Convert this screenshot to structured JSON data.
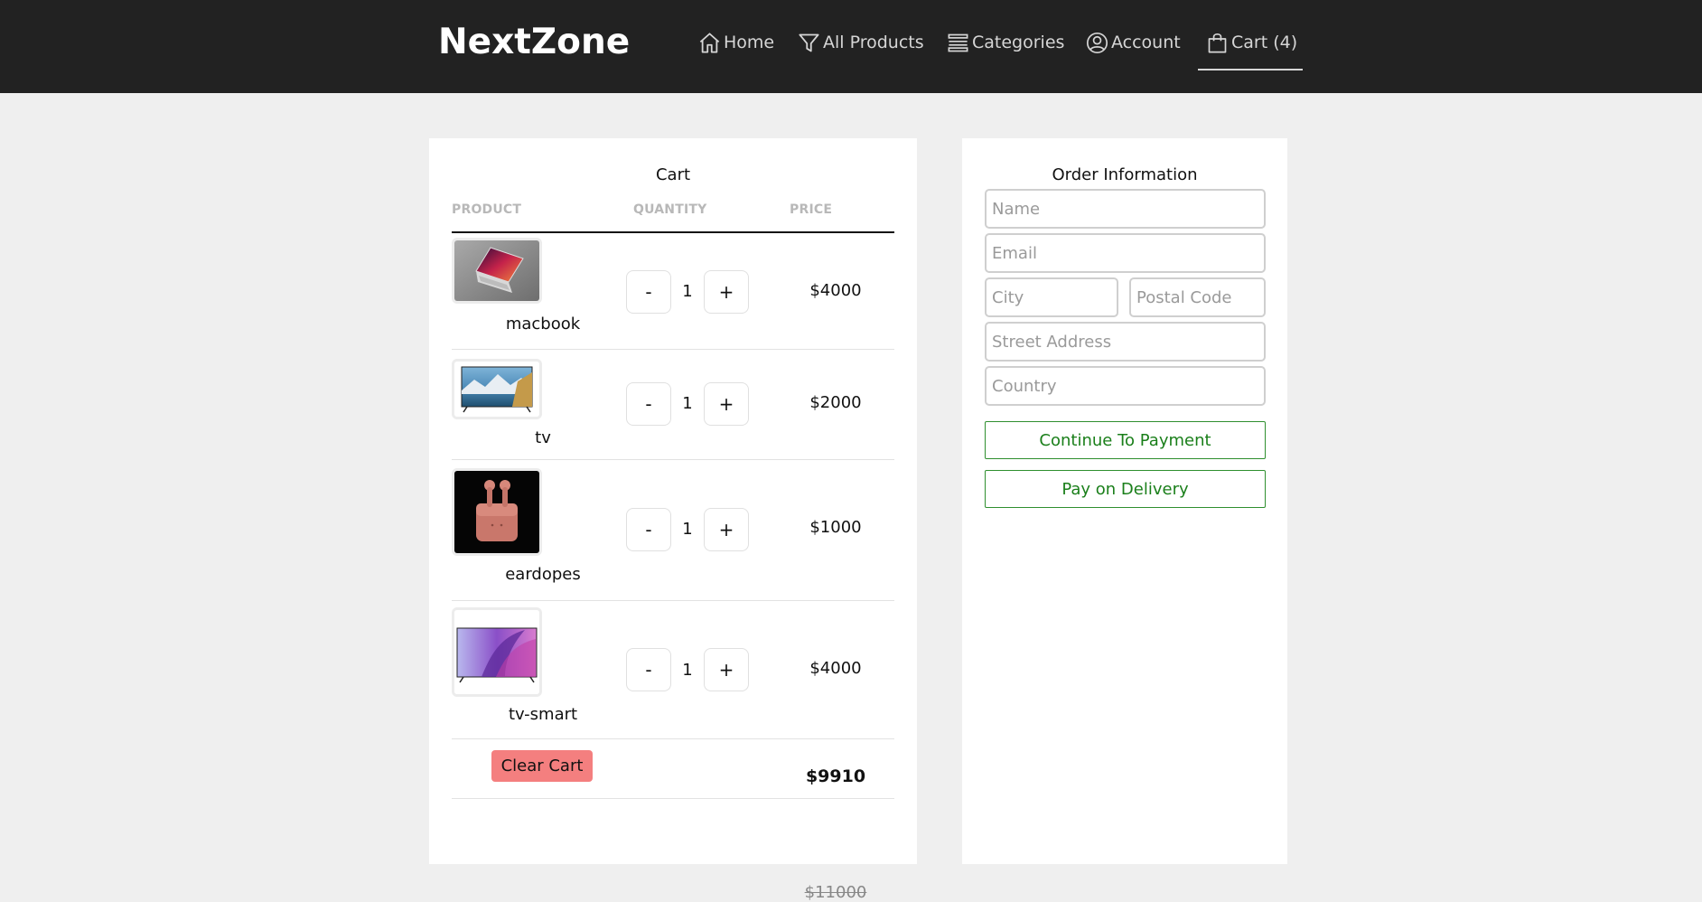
{
  "header": {
    "logo": "NextZone",
    "nav": [
      {
        "label": "Home",
        "icon": "home-icon"
      },
      {
        "label": "All Products",
        "icon": "filter-icon"
      },
      {
        "label": "Categories",
        "icon": "layers-icon"
      },
      {
        "label": "Account",
        "icon": "user-circle-icon"
      },
      {
        "label": "Cart (4)",
        "icon": "shopping-bag-icon",
        "active": true
      }
    ]
  },
  "cart": {
    "title": "Cart",
    "columns": [
      "PRODUCT",
      "QUANTITY",
      "PRICE"
    ],
    "items": [
      {
        "name": "macbook",
        "quantity": "1",
        "price": "$4000",
        "image": "laptop"
      },
      {
        "name": "tv",
        "quantity": "1",
        "price": "$2000",
        "image": "tv-landscape"
      },
      {
        "name": "eardopes",
        "quantity": "1",
        "price": "$1000",
        "image": "earbuds"
      },
      {
        "name": "tv-smart",
        "quantity": "1",
        "price": "$4000",
        "image": "tv-purple"
      }
    ],
    "minus_label": "-",
    "plus_label": "+",
    "clear_label": "Clear Cart",
    "subtotal": "$11000",
    "total": "$9910"
  },
  "order": {
    "title": "Order Information",
    "fields": {
      "name": "Name",
      "email": "Email",
      "city": "City",
      "postal": "Postal Code",
      "street": "Street Address",
      "country": "Country"
    },
    "continue_label": "Continue To Payment",
    "delivery_label": "Pay on Delivery"
  },
  "colors": {
    "header_bg": "#222222",
    "page_bg": "#efefef",
    "clear_button": "#f47f7f",
    "order_button": "#1a7f1a"
  }
}
